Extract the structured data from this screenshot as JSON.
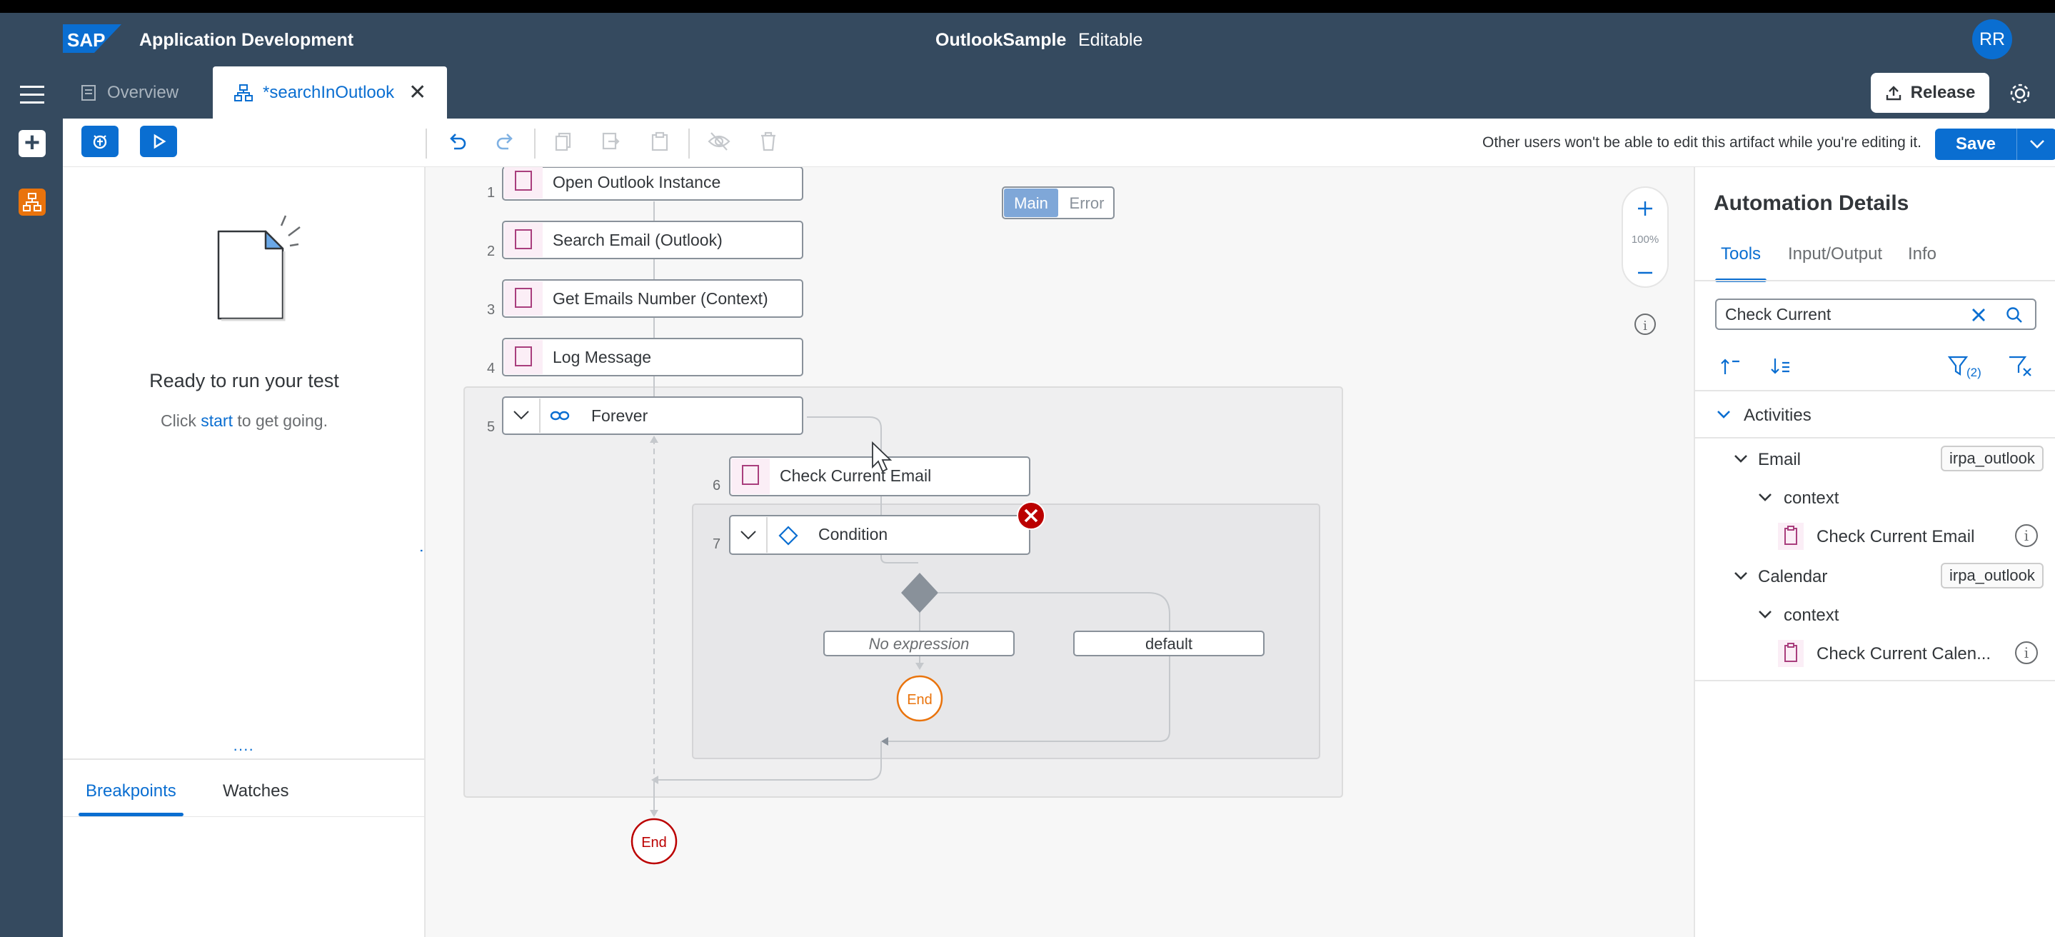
{
  "shell": {
    "logo_text": "SAP",
    "app_title": "Application Development",
    "project_name": "OutlookSample",
    "mode": "Editable",
    "avatar_initials": "RR"
  },
  "tabs": [
    {
      "label": "Overview",
      "active": false
    },
    {
      "label": "*searchInOutlook",
      "active": true
    }
  ],
  "release_label": "Release",
  "toolbar": {
    "notice": "Other users won't be able to edit this artifact while you're editing it.",
    "save_label": "Save"
  },
  "test_panel": {
    "ready_text": "Ready to run your test",
    "hint_prefix": "Click ",
    "hint_link": "start",
    "hint_suffix": " to get going.",
    "tabs": [
      "Breakpoints",
      "Watches"
    ]
  },
  "flow": {
    "toggle": {
      "main": "Main",
      "error": "Error"
    },
    "zoom_label": "100%",
    "steps": [
      {
        "num": "1",
        "label": "Open Outlook Instance"
      },
      {
        "num": "2",
        "label": "Search Email (Outlook)"
      },
      {
        "num": "3",
        "label": "Get Emails Number (Context)"
      },
      {
        "num": "4",
        "label": "Log Message"
      },
      {
        "num": "5",
        "label": "Forever"
      },
      {
        "num": "6",
        "label": "Check Current Email"
      },
      {
        "num": "7",
        "label": "Condition"
      }
    ],
    "branches": {
      "no_expression": "No expression",
      "default": "default"
    },
    "end_inner": "End",
    "end_outer": "End"
  },
  "details": {
    "title": "Automation Details",
    "tabs": [
      "Tools",
      "Input/Output",
      "Info"
    ],
    "search_value": "Check Current",
    "activities_label": "Activities",
    "groups": [
      {
        "label": "Email",
        "tag": "irpa_outlook",
        "context": "context",
        "item": "Check Current Email"
      },
      {
        "label": "Calendar",
        "tag": "irpa_outlook",
        "context": "context",
        "item": "Check Current Calen..."
      }
    ],
    "filter_count": "(2)"
  },
  "colors": {
    "shell": "#354a5f",
    "accent": "#0a6ed1",
    "error": "#bb0000",
    "end_orange": "#e9730c",
    "activity_pink": "#a93e7d"
  }
}
